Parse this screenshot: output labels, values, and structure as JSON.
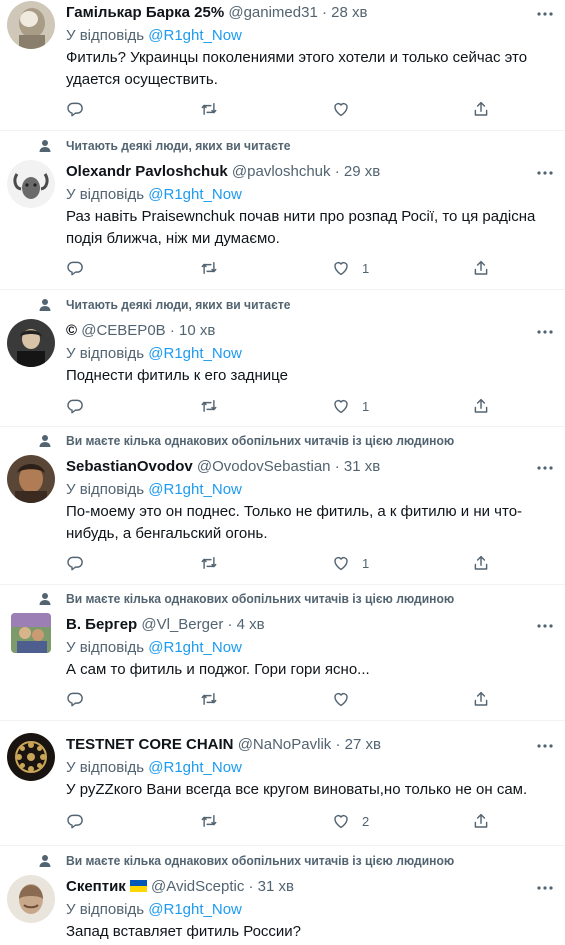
{
  "reply_prefix": "У відповідь",
  "reply_to": "@R1ght_Now",
  "dot": "·",
  "tweets": [
    {
      "name": "Гамількар Барка 25%",
      "handle": "@ganimed31",
      "time": "28 хв",
      "text": "Фитиль? Украинцы поколениями этого хотели и только сейчас это удается осуществить.",
      "likes": ""
    },
    {
      "social": "Читають деякі люди, яких ви читаєте",
      "name": "Olexandr Pavloshchuk",
      "handle": "@pavloshchuk",
      "time": "29 хв",
      "text": "Раз навіть Praisewnchuk почав нити про розпад Росії, то ця радісна подія ближча, ніж ми думаємо.",
      "likes": "1"
    },
    {
      "social": "Читають деякі люди, яких ви читаєте",
      "name": "©",
      "handle": "@СЕВЕР0В",
      "time": "10 хв",
      "text": "Поднести фитиль к его заднице",
      "likes": "1"
    },
    {
      "social": "Ви маєте кілька однакових обопільних читачів із цією людиною",
      "name": "SebastianOvodov",
      "handle": "@OvodovSebastian",
      "time": "31 хв",
      "text": "По-моему это он поднес. Только не фитиль, а к фитилю и ни что-нибудь, а бенгальский огонь.",
      "likes": "1"
    },
    {
      "social": "Ви маєте кілька однакових обопільних читачів із цією людиною",
      "name": "В. Бергер",
      "handle": "@Vl_Berger",
      "time": "4 хв",
      "text": "А сам то фитиль и поджог. Гори гори ясно...",
      "likes": ""
    },
    {
      "name": "TESTNET CORE CHAIN",
      "handle": "@NaNoPavlik",
      "time": "27 хв",
      "text": "У руZZкого Вани всегда все кругом виноваты,но только не он сам.",
      "likes": "2"
    },
    {
      "social": "Ви маєте кілька однакових обопільних читачів із цією людиною",
      "name": "Скептик",
      "handle": "@AvidSceptic",
      "time": "31 хв",
      "text": "Запад вставляет фитиль России?",
      "likes": ""
    }
  ],
  "colors": {
    "accent": "#1d9bf0",
    "muted": "#536471",
    "text": "#0f1419",
    "divider": "#eff3f4",
    "flag_blue": "#0057b7",
    "flag_yellow": "#ffd700"
  }
}
